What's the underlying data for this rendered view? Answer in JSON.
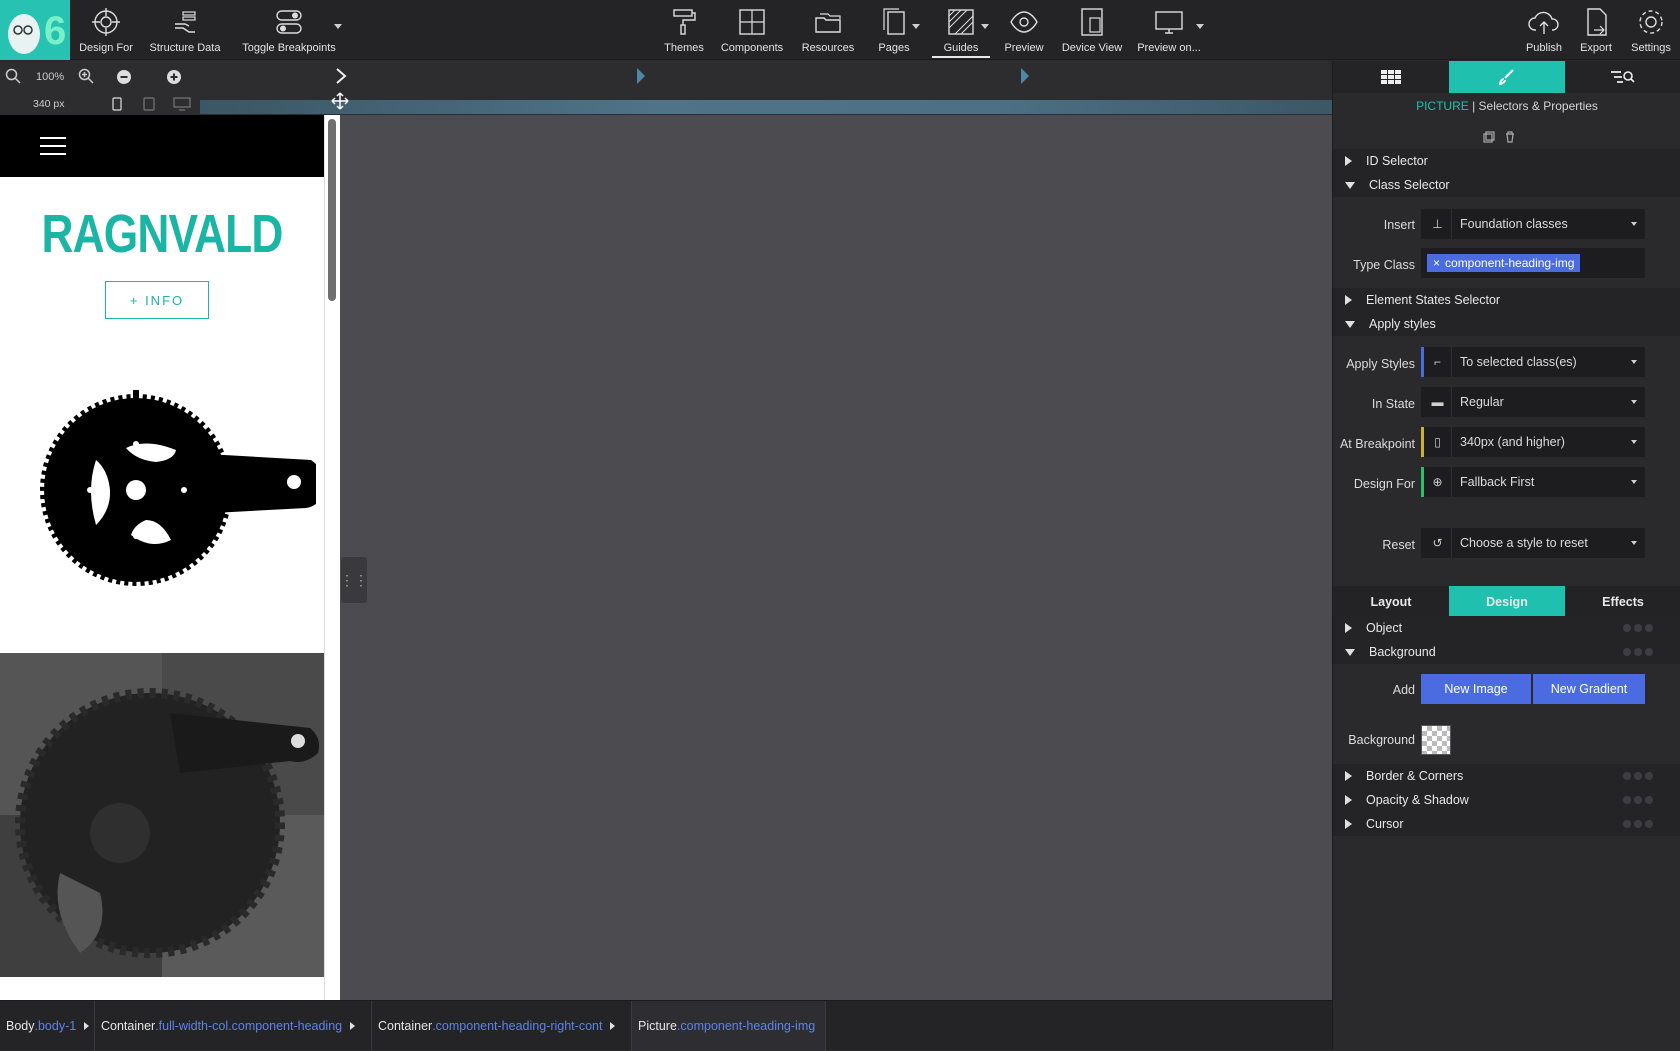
{
  "toolbar": {
    "left": [
      {
        "label": "Design For"
      },
      {
        "label": "Structure Data"
      },
      {
        "label": "Toggle Breakpoints"
      }
    ],
    "center": [
      {
        "label": "Themes"
      },
      {
        "label": "Components"
      },
      {
        "label": "Resources"
      },
      {
        "label": "Pages"
      },
      {
        "label": "Guides"
      },
      {
        "label": "Preview"
      },
      {
        "label": "Device View"
      },
      {
        "label": "Preview on..."
      }
    ],
    "right": [
      {
        "label": "Publish"
      },
      {
        "label": "Export"
      },
      {
        "label": "Settings"
      }
    ]
  },
  "zoom": {
    "level": "100%",
    "width": "340 px"
  },
  "page_preview": {
    "brand": "RAGNVALD",
    "info_button": "+ INFO",
    "brand_color": "#1ab5a4"
  },
  "panel": {
    "element_type": "PICTURE",
    "title_rest": "Selectors & Properties",
    "sections": {
      "id_selector": "ID Selector",
      "class_selector": "Class Selector",
      "element_states": "Element States Selector",
      "apply_styles": "Apply styles"
    },
    "insert": {
      "label": "Insert",
      "value": "Foundation classes"
    },
    "type_class": {
      "label": "Type Class",
      "chip": "component-heading-img"
    },
    "apply_styles_field": {
      "label": "Apply Styles",
      "value": "To selected class(es)"
    },
    "in_state": {
      "label": "In State",
      "value": "Regular"
    },
    "at_breakpoint": {
      "label": "At Breakpoint",
      "value": "340px (and higher)"
    },
    "design_for": {
      "label": "Design For",
      "value": "Fallback First"
    },
    "reset": {
      "label": "Reset",
      "value": "Choose a style to reset"
    },
    "tabs": {
      "layout": "Layout",
      "design": "Design",
      "effects": "Effects"
    },
    "design_sections": {
      "object": "Object",
      "background": "Background",
      "border": "Border & Corners",
      "opacity": "Opacity & Shadow",
      "cursor": "Cursor"
    },
    "background": {
      "add_label": "Add",
      "new_image": "New Image",
      "new_gradient": "New Gradient",
      "bg_label": "Background"
    },
    "accent_color": "#1fc0ad",
    "blue_color": "#4a6ce0"
  },
  "breadcrumbs": [
    {
      "el": "Body",
      "cls": ".body-1"
    },
    {
      "el": "Container",
      "cls": ".full-width-col.component-heading"
    },
    {
      "el": "Container",
      "cls": ".component-heading-right-cont"
    },
    {
      "el": "Picture",
      "cls": ".component-heading-img"
    }
  ]
}
